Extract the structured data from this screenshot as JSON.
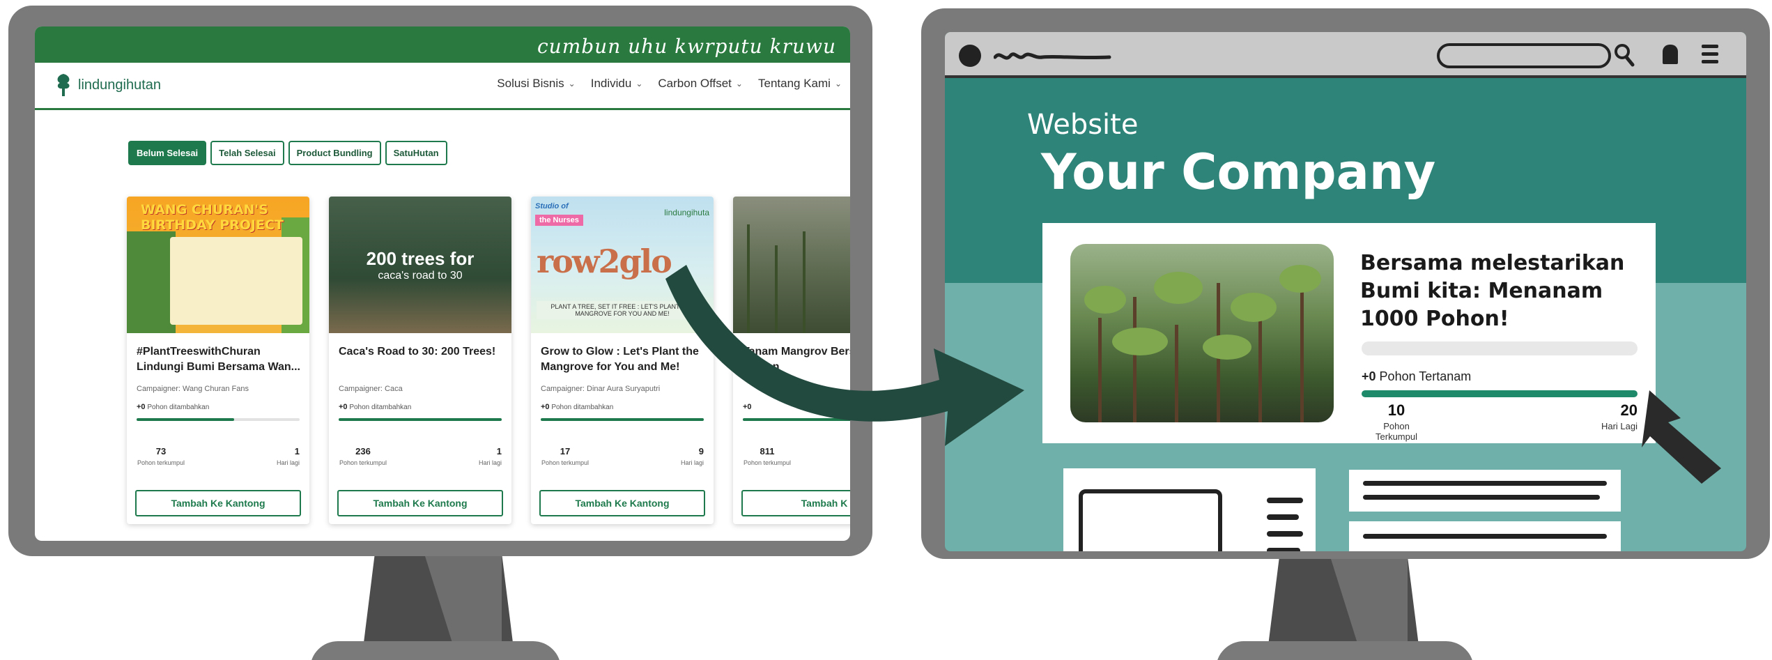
{
  "left_site": {
    "header_script": "cumbun uhu kwrputu kruwu",
    "logo_text": "lindungihutan",
    "nav": [
      {
        "label": "Solusi Bisnis"
      },
      {
        "label": "Individu"
      },
      {
        "label": "Carbon Offset"
      },
      {
        "label": "Tentang Kami"
      }
    ],
    "tabs": [
      {
        "label": "Belum Selesai",
        "active": true
      },
      {
        "label": "Telah Selesai",
        "active": false
      },
      {
        "label": "Product Bundling",
        "active": false
      },
      {
        "label": "SatuHutan",
        "active": false
      }
    ],
    "cards": [
      {
        "thumb_text": "WANG CHURAN'S BIRTHDAY PROJECT",
        "title": "#PlantTreeswithChuran Lindungi Bumi Bersama Wan...",
        "campaigner": "Campaigner: Wang Churan Fans",
        "added_count": "+0",
        "added_label": "Pohon ditambahkan",
        "progress": 0.6,
        "collected": "73",
        "collected_label": "Pohon terkumpul",
        "days": "1",
        "days_label": "Hari lagi",
        "button": "Tambah Ke Kantong"
      },
      {
        "thumb_big": "200 trees for",
        "thumb_small": "caca's road to 30",
        "title": "Caca's Road to 30: 200 Trees!",
        "campaigner": "Campaigner: Caca",
        "added_count": "+0",
        "added_label": "Pohon ditambahkan",
        "progress": 1.0,
        "collected": "236",
        "collected_label": "Pohon terkumpul",
        "days": "1",
        "days_label": "Hari lagi",
        "button": "Tambah Ke Kantong"
      },
      {
        "thumb_top": "Studio of",
        "thumb_pink": "the Nurses",
        "thumb_logo": "lindungihuta",
        "thumb_word": "row2glo",
        "thumb_foot": "PLANT A TREE, SET IT FREE : LET'S PLANT THE MANGROVE FOR YOU AND ME!",
        "title": "Grow to Glow : Let's Plant the Mangrove for You and Me!",
        "campaigner": "Campaigner: Dinar Aura Suryaputri",
        "added_count": "+0",
        "added_label": "Pohon ditambahkan",
        "progress": 1.0,
        "collected": "17",
        "collected_label": "Pohon terkumpul",
        "days": "9",
        "days_label": "Hari lagi",
        "button": "Tambah Ke Kantong"
      },
      {
        "title": "Tanam Mangrov Bersama Tristan",
        "campaigner": "",
        "added_count": "+0",
        "added_label": "",
        "progress": 1.0,
        "collected": "811",
        "collected_label": "Pohon terkumpul",
        "days": "",
        "days_label": "",
        "button": "Tambah K"
      }
    ]
  },
  "right_illustration": {
    "label": "Website",
    "company": "Your Company",
    "card_title": "Bersama melestarikan Bumi kita: Menanam 1000 Pohon!",
    "planted_count": "+0",
    "planted_label": "Pohon Tertanam",
    "progress": 1.0,
    "collected": "10",
    "collected_label": "Pohon Terkumpul",
    "days": "20",
    "days_label": "Hari Lagi"
  },
  "colors": {
    "brand_green": "#2a7a3f",
    "teal": "#2e8479",
    "light_teal": "#6fb0aa",
    "arrow": "#234a3f",
    "monitor": "#7a7a7a"
  },
  "icons": [
    "tree-logo-icon",
    "chevron-down-icon",
    "search-icon",
    "bell-icon",
    "hamburger-icon",
    "cursor-icon",
    "curved-arrow-icon"
  ]
}
